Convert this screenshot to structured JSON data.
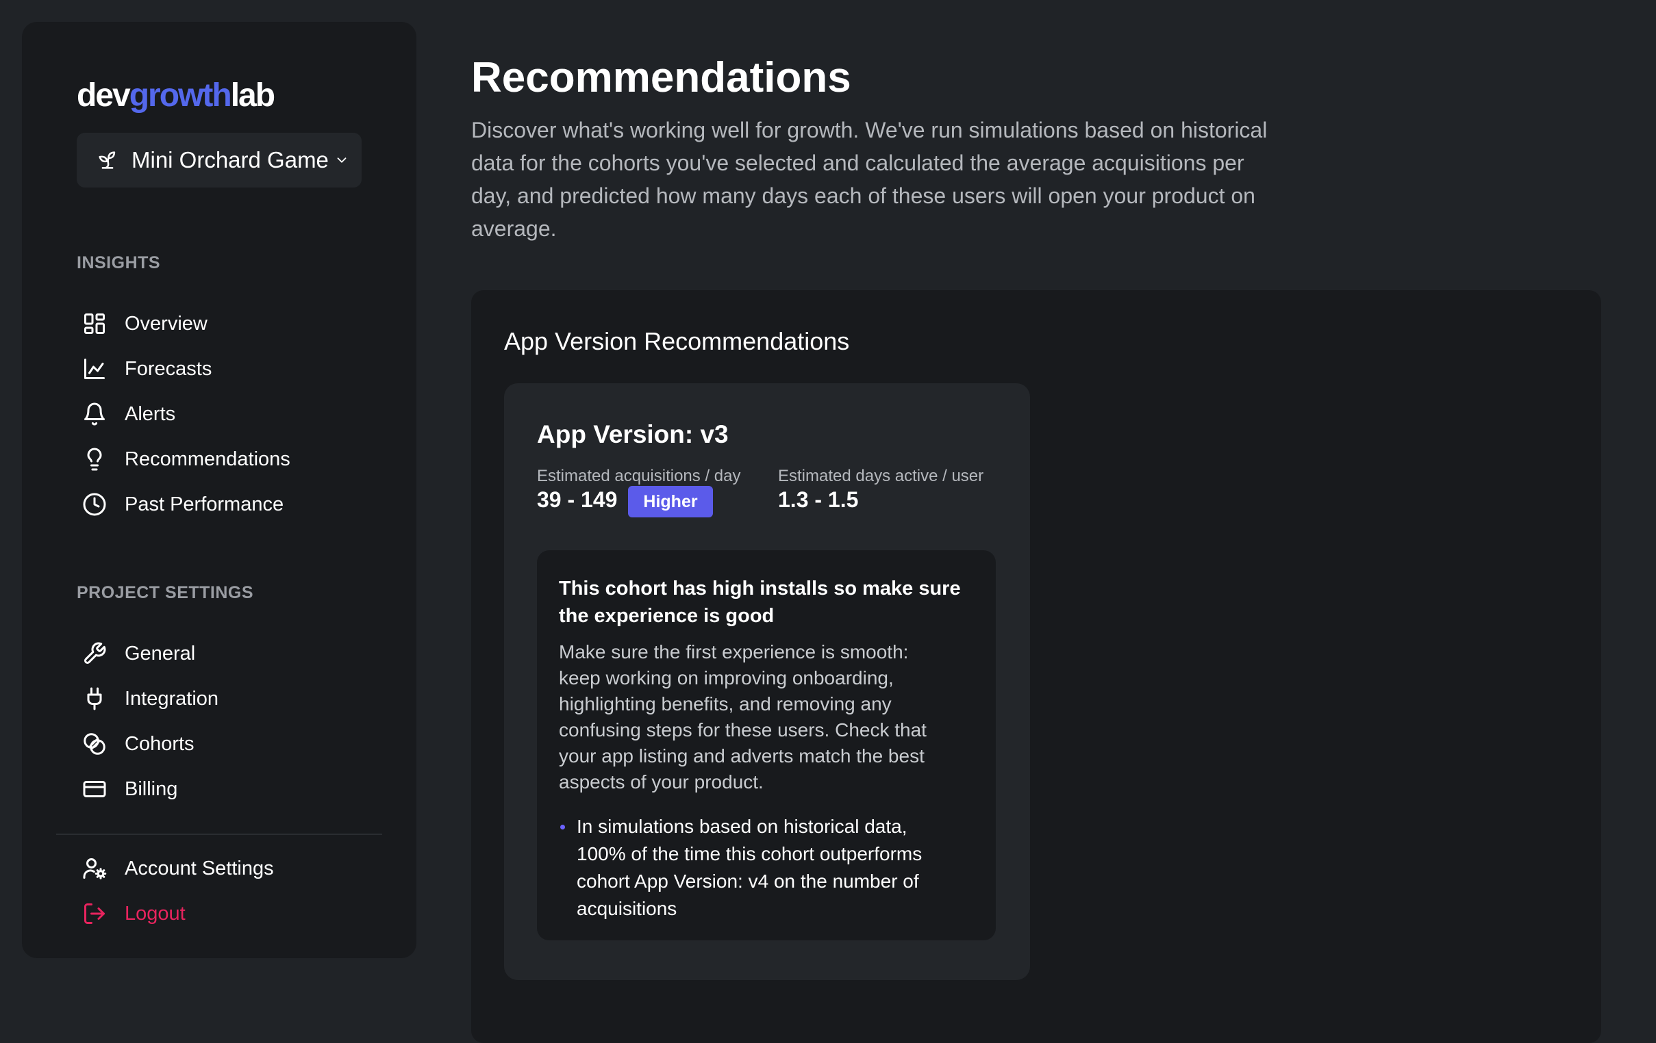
{
  "logo": {
    "part1": "dev",
    "part2": "growth",
    "part3": "lab"
  },
  "project_selector": {
    "value": "Mini Orchard Game"
  },
  "sidebar": {
    "insights_label": "INSIGHTS",
    "insights": [
      {
        "label": "Overview",
        "icon": "grid-icon"
      },
      {
        "label": "Forecasts",
        "icon": "line-chart-icon"
      },
      {
        "label": "Alerts",
        "icon": "bell-icon"
      },
      {
        "label": "Recommendations",
        "icon": "lightbulb-icon"
      },
      {
        "label": "Past Performance",
        "icon": "clock-icon"
      }
    ],
    "settings_label": "PROJECT SETTINGS",
    "settings": [
      {
        "label": "General",
        "icon": "wrench-icon"
      },
      {
        "label": "Integration",
        "icon": "plug-icon"
      },
      {
        "label": "Cohorts",
        "icon": "overlap-circles-icon"
      },
      {
        "label": "Billing",
        "icon": "credit-card-icon"
      }
    ],
    "account": {
      "label": "Account Settings",
      "icon": "user-gear-icon"
    },
    "logout": {
      "label": "Logout",
      "icon": "logout-icon"
    }
  },
  "main": {
    "title": "Recommendations",
    "description": "Discover what's working well for growth. We've run simulations based on historical data for the cohorts you've selected and calculated the average acquisitions per day, and predicted how many days each of these users will open your product on average.",
    "panel_title": "App Version Recommendations",
    "card": {
      "title": "App Version: v3",
      "acq_label": "Estimated acquisitions / day",
      "acq_value": "39 - 149",
      "badge": "Higher",
      "days_label": "Estimated days active / user",
      "days_value": "1.3 - 1.5",
      "tip_title": "This cohort has high installs so make sure the experience is good",
      "tip_body": "Make sure the first experience is smooth: keep working on improving onboarding, highlighting benefits, and removing any confusing steps for these users. Check that your app listing and adverts match the best aspects of your product.",
      "tip_points": [
        "In simulations based on historical data, 100% of the time this cohort outperforms cohort App Version: v4 on the number of acquisitions"
      ]
    }
  },
  "colors": {
    "background": "#202327",
    "sidebar": "#181a1d",
    "accent": "#5468ec",
    "badge": "#5b5bea",
    "logout": "#e8245e"
  }
}
